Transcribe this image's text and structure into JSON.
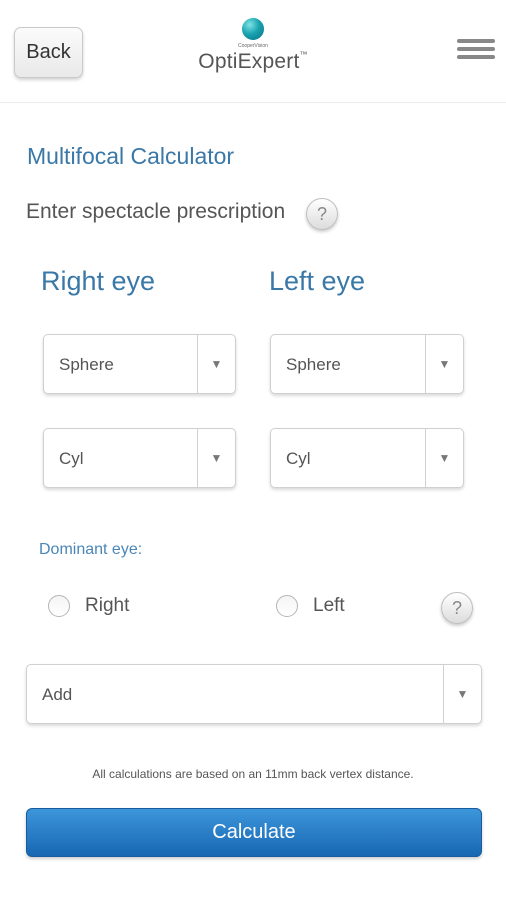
{
  "header": {
    "back_label": "Back",
    "logo_small_text": "CooperVision",
    "app_name": "OptiExpert",
    "trademark": "™"
  },
  "main": {
    "title": "Multifocal Calculator",
    "subtitle": "Enter spectacle prescription",
    "help_symbol": "?",
    "right_eye": {
      "heading": "Right eye",
      "sphere": "Sphere",
      "cyl": "Cyl"
    },
    "left_eye": {
      "heading": "Left eye",
      "sphere": "Sphere",
      "cyl": "Cyl"
    },
    "dominant_eye": {
      "label": "Dominant eye:",
      "options": [
        "Right",
        "Left"
      ],
      "selected": null
    },
    "add_select": "Add",
    "note": "All calculations are based on an 11mm back vertex distance.",
    "calculate_label": "Calculate"
  },
  "icons": {
    "dropdown_arrow": "▼"
  },
  "colors": {
    "accent": "#3a78a8",
    "button_blue": "#1f74c2"
  }
}
